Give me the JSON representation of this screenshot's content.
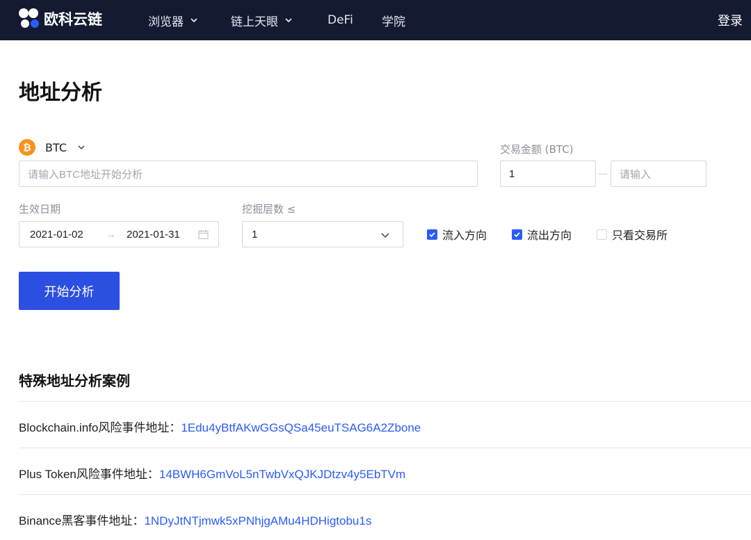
{
  "brand": {
    "name": "欧科云链"
  },
  "nav": {
    "items": [
      {
        "label": "浏览器",
        "has_dropdown": true
      },
      {
        "label": "链上天眼",
        "has_dropdown": true
      },
      {
        "label": "DeFi",
        "has_dropdown": false
      },
      {
        "label": "学院",
        "has_dropdown": false
      }
    ],
    "login": "登录"
  },
  "page": {
    "title": "地址分析"
  },
  "form": {
    "coin": {
      "label": "BTC",
      "icon": "bitcoin-icon",
      "color": "#f7931a"
    },
    "address": {
      "placeholder": "请输入BTC地址开始分析"
    },
    "amount": {
      "label": "交易金额 (BTC)",
      "min_value": "1",
      "max_placeholder": "请输入"
    },
    "date": {
      "label": "生效日期",
      "start": "2021-01-02",
      "arrow": "→",
      "end": "2021-01-31"
    },
    "depth": {
      "label": "挖掘层数 ≤",
      "value": "1"
    },
    "checkboxes": [
      {
        "label": "流入方向",
        "checked": true
      },
      {
        "label": "流出方向",
        "checked": true
      },
      {
        "label": "只看交易所",
        "checked": false
      }
    ],
    "submit": "开始分析"
  },
  "cases": {
    "title": "特殊地址分析案例",
    "items": [
      {
        "label": "Blockchain.info风险事件地址：",
        "address": "1Edu4yBtfAKwGGsQSa45euTSAG6A2Zbone"
      },
      {
        "label": "Plus Token风险事件地址：",
        "address": "14BWH6GmVoL5nTwbVxQJKJDtzv4y5EbTVm"
      },
      {
        "label": "Binance黑客事件地址：",
        "address": "1NDyJtNTjmwk5xPNhjgAMu4HDHigtobu1s"
      }
    ]
  },
  "colors": {
    "nav_bg": "#131a31",
    "primary": "#2b4fe0",
    "link": "#2b5bfa"
  }
}
